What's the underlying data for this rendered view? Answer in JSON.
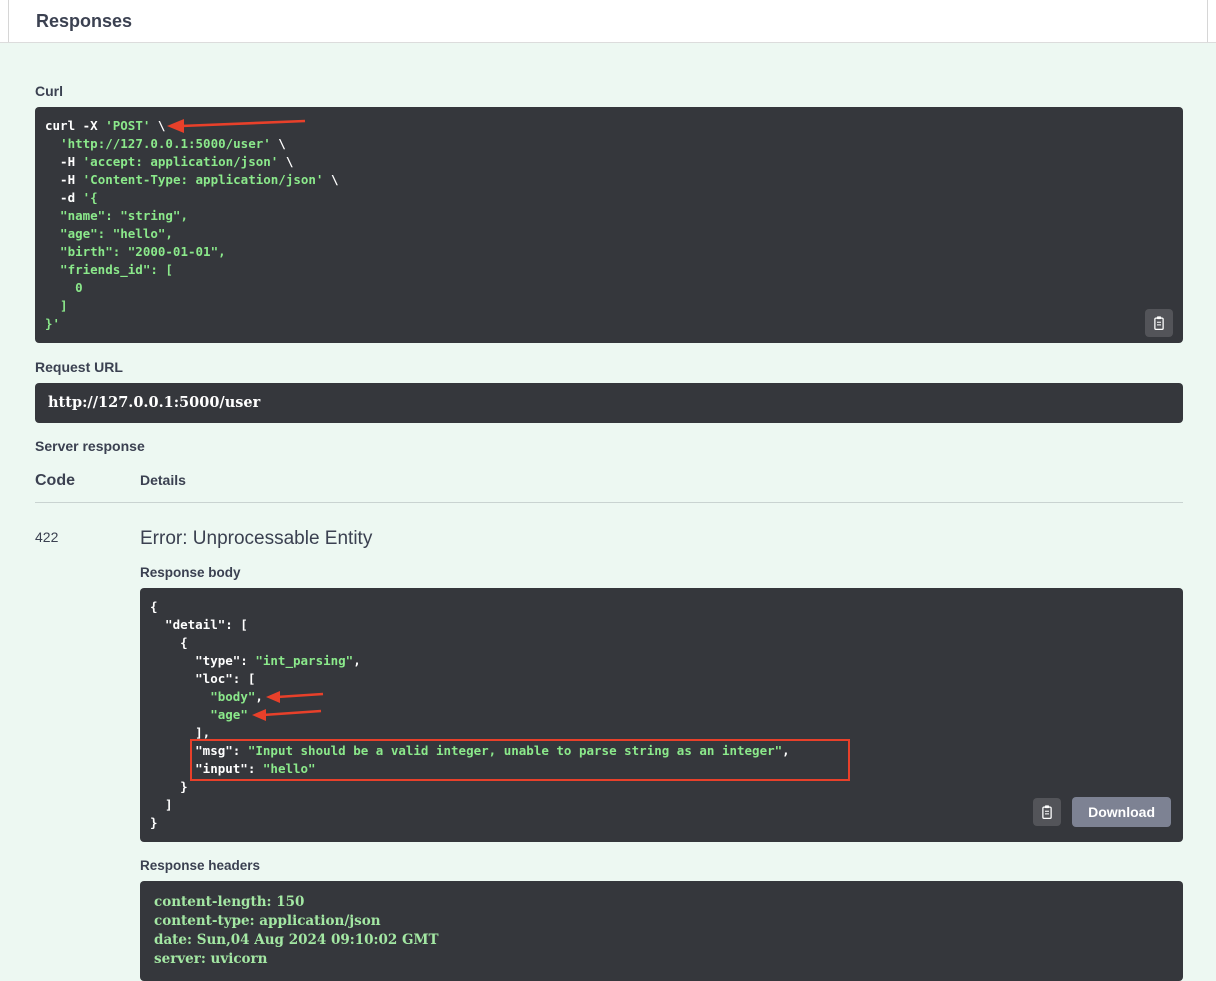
{
  "colors": {
    "panel_bg": "#edf8f2",
    "code_bg": "#35373c",
    "code_plain": "#ffffff",
    "code_string": "#8be98b",
    "headers_text": "#a3e7a3",
    "annotation_red": "#e8402a",
    "text_dark": "#3b4151",
    "download_bg": "#7d8293"
  },
  "responses_header": {
    "title": "Responses"
  },
  "curl": {
    "label": "Curl",
    "lines": [
      [
        {
          "t": "curl -X ",
          "c": "p"
        },
        {
          "t": "'POST'",
          "c": "s"
        },
        {
          "t": " \\",
          "c": "p"
        }
      ],
      [
        {
          "t": "  ",
          "c": "p"
        },
        {
          "t": "'http://127.0.0.1:5000/user'",
          "c": "s"
        },
        {
          "t": " \\",
          "c": "p"
        }
      ],
      [
        {
          "t": "  -H ",
          "c": "p"
        },
        {
          "t": "'accept: application/json'",
          "c": "s"
        },
        {
          "t": " \\",
          "c": "p"
        }
      ],
      [
        {
          "t": "  -H ",
          "c": "p"
        },
        {
          "t": "'Content-Type: application/json'",
          "c": "s"
        },
        {
          "t": " \\",
          "c": "p"
        }
      ],
      [
        {
          "t": "  -d ",
          "c": "p"
        },
        {
          "t": "'{",
          "c": "s"
        }
      ],
      [
        {
          "t": "  \"name\": \"string\",",
          "c": "s"
        }
      ],
      [
        {
          "t": "  \"age\": \"hello\",",
          "c": "s"
        }
      ],
      [
        {
          "t": "  \"birth\": \"2000-01-01\",",
          "c": "s"
        }
      ],
      [
        {
          "t": "  \"friends_id\": [",
          "c": "s"
        }
      ],
      [
        {
          "t": "    0",
          "c": "s"
        }
      ],
      [
        {
          "t": "  ]",
          "c": "s"
        }
      ],
      [
        {
          "t": "}'",
          "c": "s"
        }
      ]
    ]
  },
  "request_url": {
    "label": "Request URL",
    "value": "http://127.0.0.1:5000/user"
  },
  "server_response": {
    "label": "Server response",
    "table": {
      "code_header": "Code",
      "details_header": "Details"
    },
    "row": {
      "code": "422",
      "status": "Error: Unprocessable Entity",
      "response_body": {
        "label": "Response body",
        "download_label": "Download",
        "lines": [
          [
            {
              "t": "{",
              "c": "p"
            }
          ],
          [
            {
              "t": "  \"detail\": [",
              "c": "p"
            }
          ],
          [
            {
              "t": "    {",
              "c": "p"
            }
          ],
          [
            {
              "t": "      \"type\": ",
              "c": "p"
            },
            {
              "t": "\"int_parsing\"",
              "c": "s"
            },
            {
              "t": ",",
              "c": "p"
            }
          ],
          [
            {
              "t": "      \"loc\": [",
              "c": "p"
            }
          ],
          [
            {
              "t": "        ",
              "c": "p"
            },
            {
              "t": "\"body\"",
              "c": "s"
            },
            {
              "t": ",",
              "c": "p"
            }
          ],
          [
            {
              "t": "        ",
              "c": "p"
            },
            {
              "t": "\"age\"",
              "c": "s"
            }
          ],
          [
            {
              "t": "      ],",
              "c": "p"
            }
          ],
          [
            {
              "t": "      \"msg\": ",
              "c": "p"
            },
            {
              "t": "\"Input should be a valid integer, unable to parse string as an integer\"",
              "c": "s"
            },
            {
              "t": ",",
              "c": "p"
            }
          ],
          [
            {
              "t": "      \"input\": ",
              "c": "p"
            },
            {
              "t": "\"hello\"",
              "c": "s"
            }
          ],
          [
            {
              "t": "    }",
              "c": "p"
            }
          ],
          [
            {
              "t": "  ]",
              "c": "p"
            }
          ],
          [
            {
              "t": "}",
              "c": "p"
            }
          ]
        ]
      },
      "response_headers": {
        "label": "Response headers",
        "lines": [
          [
            {
              "t": "content-length: 150",
              "c": "h"
            }
          ],
          [
            {
              "t": "content-type: application/json",
              "c": "h"
            }
          ],
          [
            {
              "t": "date: Sun,04 Aug 2024 09:10:02 GMT",
              "c": "h"
            }
          ],
          [
            {
              "t": "server: uvicorn",
              "c": "h"
            }
          ]
        ]
      }
    }
  }
}
